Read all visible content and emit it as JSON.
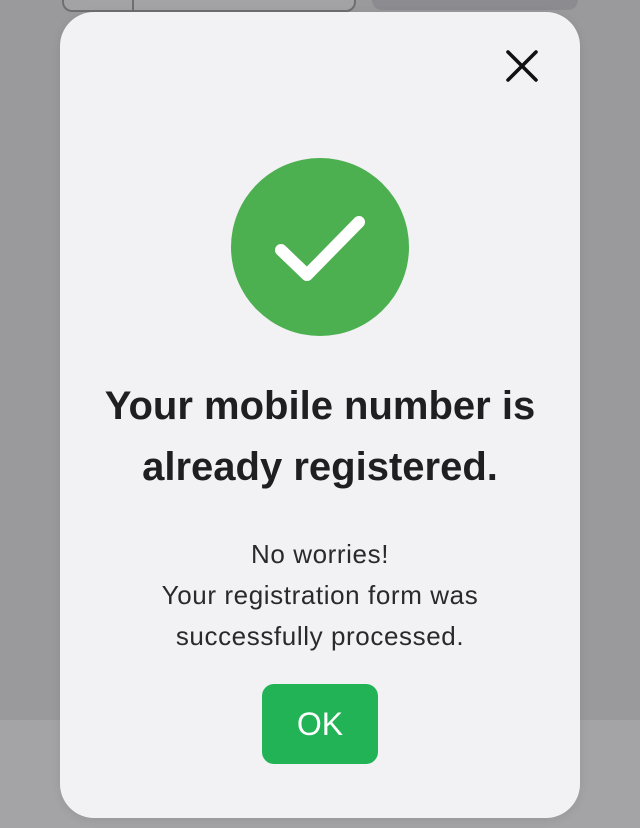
{
  "dialog": {
    "title_line1": "Your mobile number is",
    "title_line2": "already registered.",
    "message_line1": "No worries!",
    "message_line2": "Your registration form was",
    "message_line3": "successfully processed.",
    "ok_label": "OK",
    "close_icon": "close-icon",
    "status_icon": "checkmark-icon",
    "success_color": "#4caf50",
    "ok_color": "#22b357"
  }
}
